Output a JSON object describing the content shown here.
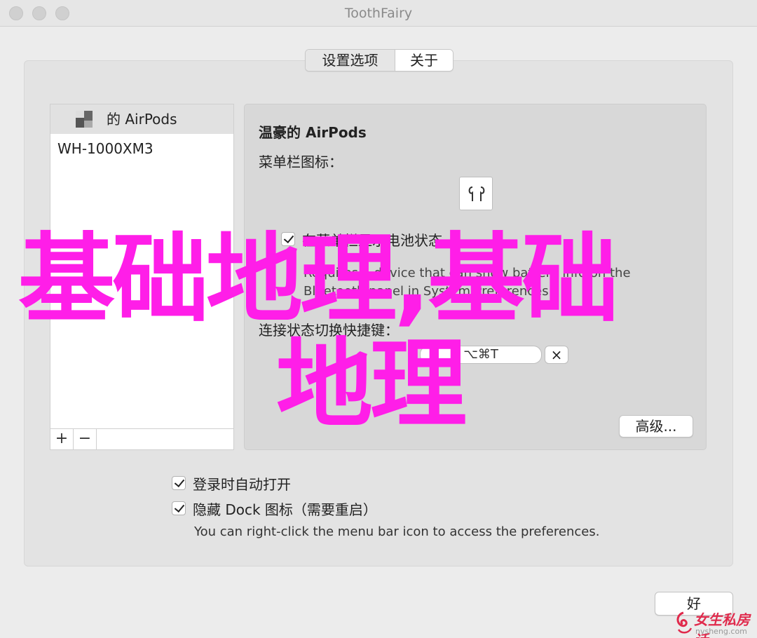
{
  "window": {
    "title": "ToothFairy"
  },
  "tabs": [
    {
      "label": "设置选项",
      "active": true
    },
    {
      "label": "关于",
      "active": false
    }
  ],
  "devices": [
    {
      "label": "的 AirPods",
      "selected": true
    },
    {
      "label": "WH-1000XM3",
      "selected": false
    }
  ],
  "list_footer": {
    "add": "+",
    "remove": "−"
  },
  "detail": {
    "title": "温豪的 AirPods",
    "menubar_icon_label": "菜单栏图标：",
    "icon": "airpods-icon",
    "battery_checkbox": {
      "label": "在菜单栏显示电池状态",
      "checked": true
    },
    "battery_desc": "Requires a device that can show battery info on the Bluetooth panel in System Preferences",
    "shortcut_label": "连接状态切换快捷键：",
    "shortcut_value": "⌥⌘T",
    "shortcut_clear": "×",
    "advanced_button": "高级..."
  },
  "options": {
    "launch_at_login": {
      "label": "登录时自动打开",
      "checked": true
    },
    "hide_dock": {
      "label": "隐藏 Dock 图标（需要重启）",
      "checked": true
    },
    "hint": "You can right-click the menu bar icon to access the preferences."
  },
  "ok_button": "好",
  "overlay": {
    "line1": "基础地理,基础",
    "line2": "地理",
    "color": "#ff1ee8"
  },
  "logo": {
    "text": "女生私房话",
    "sub": "nvsheng.com"
  }
}
